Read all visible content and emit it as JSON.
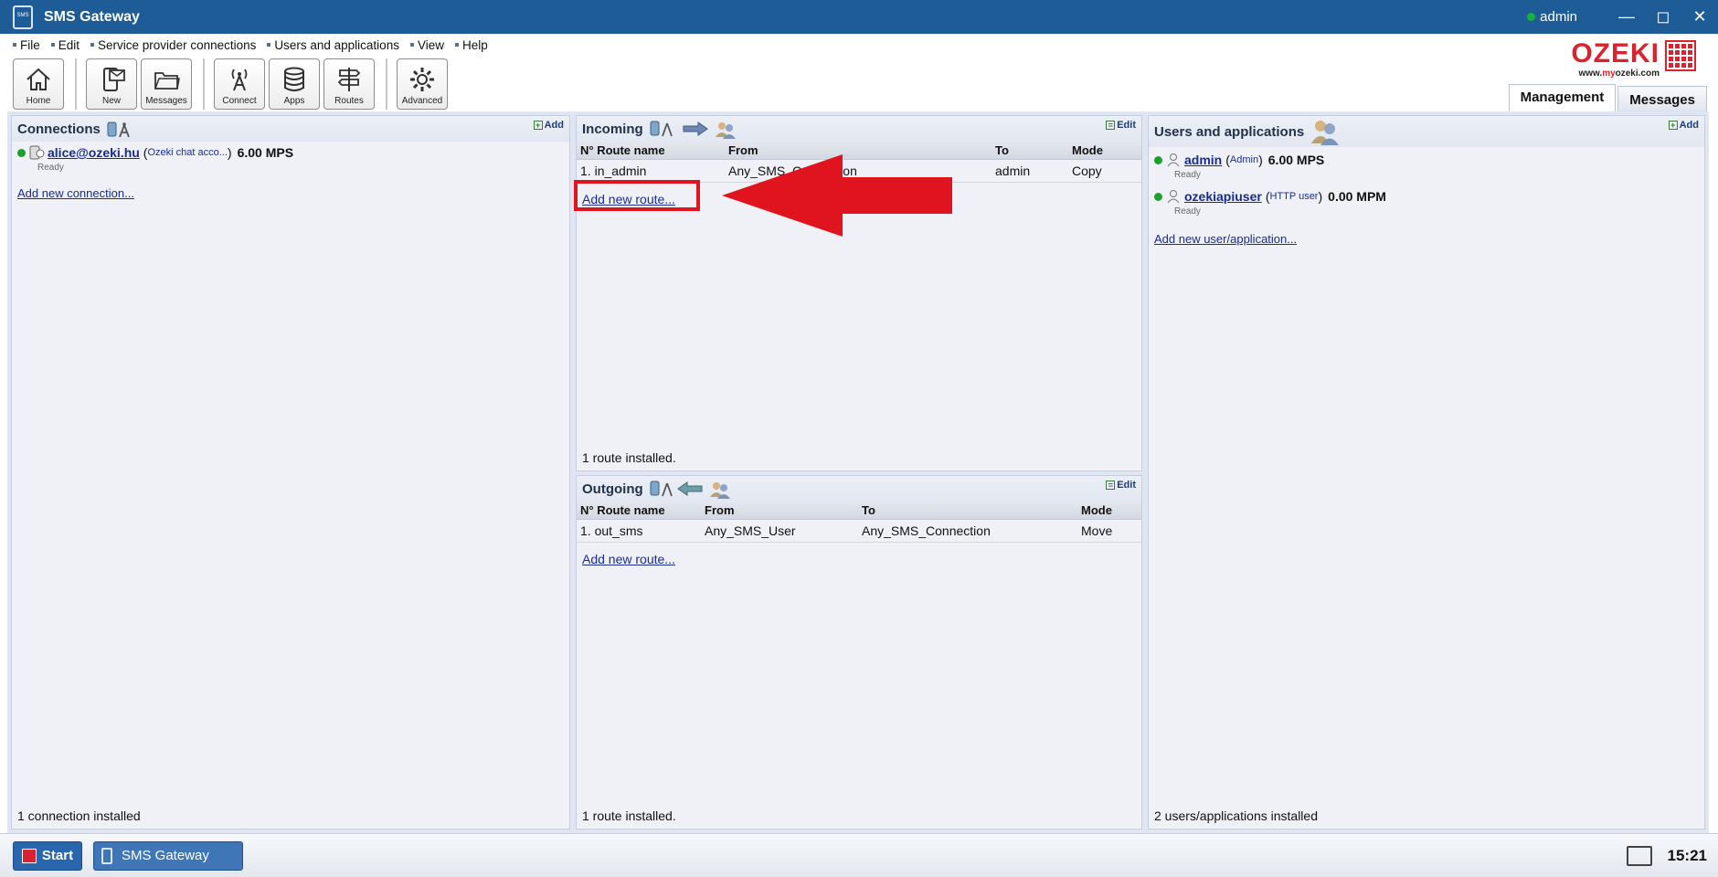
{
  "window": {
    "title": "SMS Gateway",
    "user": "admin"
  },
  "menu": [
    "File",
    "Edit",
    "Service provider connections",
    "Users and applications",
    "View",
    "Help"
  ],
  "toolbar": {
    "home": "Home",
    "new": "New",
    "messages": "Messages",
    "connect": "Connect",
    "apps": "Apps",
    "routes": "Routes",
    "advanced": "Advanced"
  },
  "logo": {
    "word": "OZEKI",
    "url_prefix": "www.",
    "url_brand": "my",
    "url_suffix": "ozeki.com"
  },
  "tabs": {
    "management": "Management",
    "messages": "Messages"
  },
  "connections": {
    "title": "Connections",
    "add": "Add",
    "item": {
      "name": "alice@ozeki.hu",
      "type": "Ozeki chat acco...",
      "speed": "6.00 MPS",
      "status": "Ready"
    },
    "add_link": "Add new connection...",
    "footer": "1 connection installed"
  },
  "incoming": {
    "title": "Incoming",
    "edit": "Edit",
    "headers": [
      "N° Route name",
      "From",
      "To",
      "Mode"
    ],
    "rows": [
      {
        "n": "1.",
        "name": "in_admin",
        "from": "Any_SMS_Connection",
        "to": "admin",
        "mode": "Copy"
      }
    ],
    "add_link": "Add new route...",
    "footer": "1 route installed."
  },
  "outgoing": {
    "title": "Outgoing",
    "edit": "Edit",
    "headers": [
      "N° Route name",
      "From",
      "To",
      "Mode"
    ],
    "rows": [
      {
        "n": "1.",
        "name": "out_sms",
        "from": "Any_SMS_User",
        "to": "Any_SMS_Connection",
        "mode": "Move"
      }
    ],
    "add_link": "Add new route...",
    "footer": "1 route installed."
  },
  "users": {
    "title": "Users and applications",
    "add": "Add",
    "items": [
      {
        "name": "admin",
        "type": "Admin",
        "speed": "6.00 MPS",
        "status": "Ready"
      },
      {
        "name": "ozekiapiuser",
        "type": "HTTP user",
        "speed": "0.00 MPM",
        "status": "Ready"
      }
    ],
    "add_link": "Add new user/application...",
    "footer": "2 users/applications installed"
  },
  "taskbar": {
    "start": "Start",
    "task": "SMS Gateway",
    "clock": "15:21"
  },
  "colors": {
    "titlebar": "#1e5c97",
    "accent_red": "#d9232e",
    "link": "#1a2c8f",
    "status_green": "#1aa12d"
  }
}
